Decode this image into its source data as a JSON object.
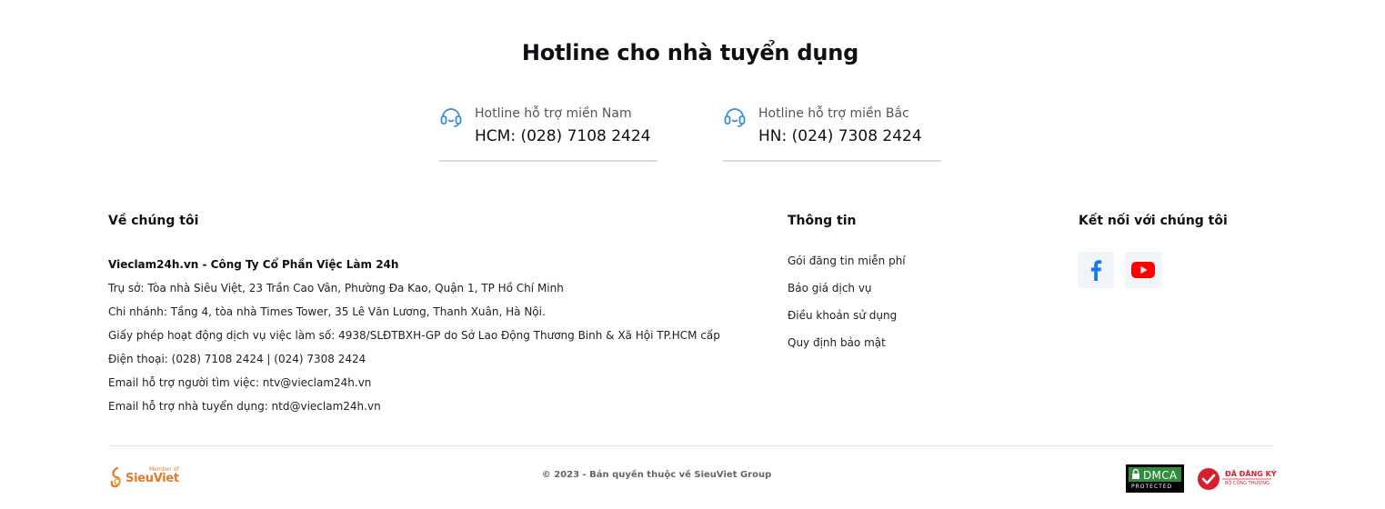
{
  "hotline": {
    "title": "Hotline cho nhà tuyển dụng",
    "south": {
      "label": "Hotline hỗ trợ miền Nam",
      "number": "HCM: (028) 7108 2424",
      "icon": "headset-icon"
    },
    "north": {
      "label": "Hotline hỗ trợ miền Bắc",
      "number": "HN: (024) 7308 2424",
      "icon": "headset-icon"
    }
  },
  "about": {
    "title": "Về chúng tôi",
    "company": "Vieclam24h.vn - Công Ty Cổ Phần Việc Làm 24h",
    "lines": [
      "Trụ sở: Tòa nhà Siêu Việt, 23 Trần Cao Vân, Phường Đa Kao, Quận 1, TP Hồ Chí Minh",
      "Chi nhánh: Tầng 4, tòa nhà Times Tower, 35 Lê Văn Lương, Thanh Xuân, Hà Nội.",
      "Giấy phép hoạt động dịch vụ việc làm số: 4938/SLĐTBXH-GP do Sở Lao Động Thương Binh & Xã Hội TP.HCM cấp",
      "Điện thoại: (028) 7108 2424 | (024) 7308 2424",
      "Email hỗ trợ người tìm việc: ntv@vieclam24h.vn",
      "Email hỗ trợ nhà tuyển dụng: ntd@vieclam24h.vn"
    ]
  },
  "info": {
    "title": "Thông tin",
    "links": [
      "Gói đăng tin miễn phí",
      "Báo giá dịch vụ",
      "Điều khoản sử dụng",
      "Quy định bảo mật"
    ]
  },
  "social": {
    "title": "Kết nối với chúng tôi",
    "facebook_icon": "facebook-icon",
    "youtube_icon": "youtube-icon",
    "colors": {
      "facebook": "#1877f2",
      "youtube": "#ff0000"
    }
  },
  "footer": {
    "brand_member": "Member of",
    "brand_name": "SieuViet",
    "copyright": "© 2023 - Bản quyền thuộc về SieuViet Group",
    "dmca_text": "DMCA",
    "dmca_sub": "PROTECTED",
    "bct_text": "ĐÃ ĐĂNG KÝ",
    "bct_sub": "BỘ CÔNG THƯƠNG"
  },
  "colors": {
    "accent": "#3b8fd9",
    "brand": "#e07b2a",
    "text": "#111111",
    "divider": "#e4e4e4"
  }
}
